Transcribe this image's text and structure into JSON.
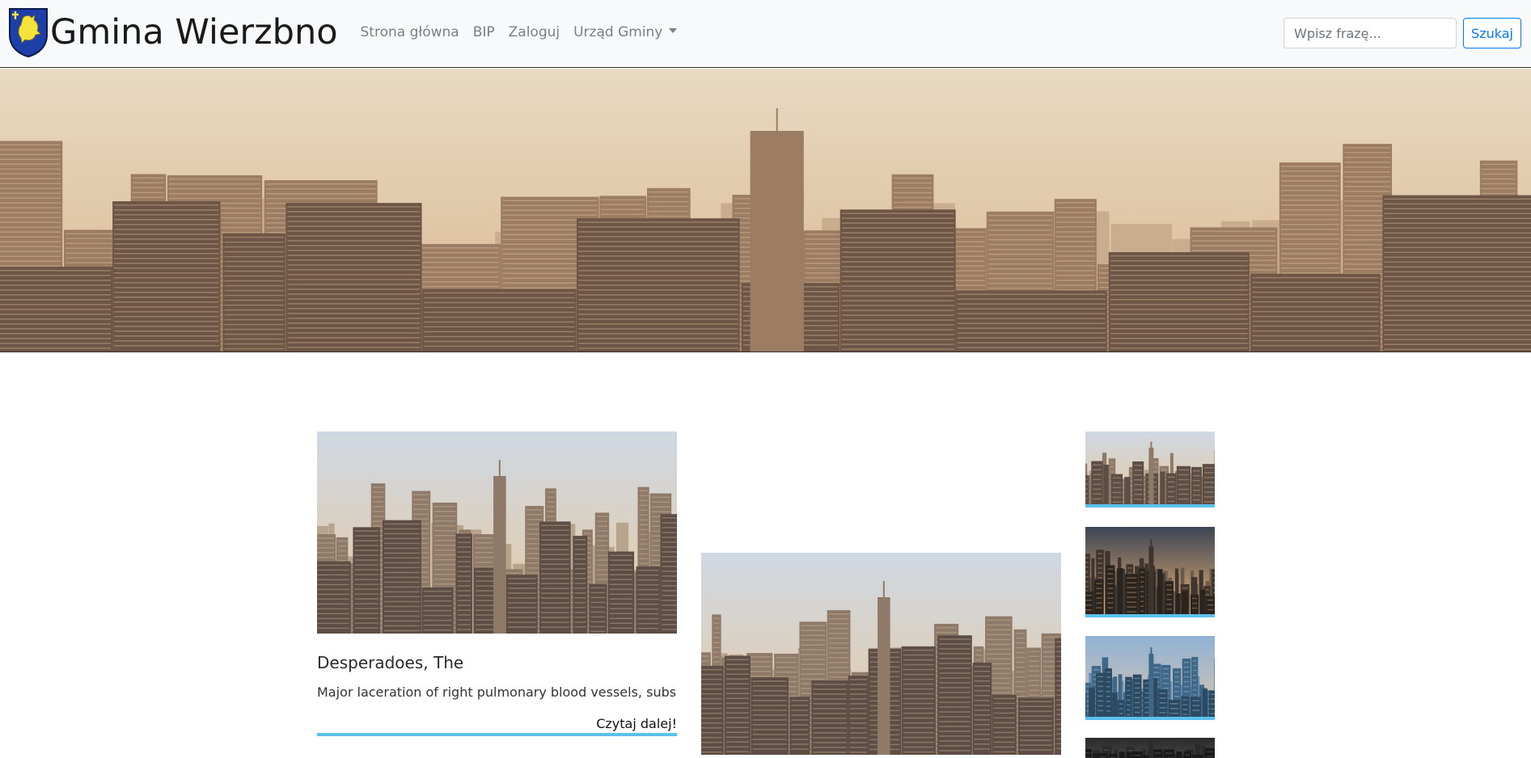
{
  "site": {
    "title": "Gmina Wierzbno"
  },
  "nav": {
    "items": [
      "Strona główna",
      "BIP",
      "Zaloguj",
      "Urząd Gminy"
    ]
  },
  "search": {
    "placeholder": "Wpisz frazę...",
    "button_label": "Szukaj"
  },
  "articles": [
    {
      "title": "Desperadoes, The",
      "excerpt": "Major laceration of right pulmonary blood vessels, subs",
      "read_more": "Czytaj dalej!"
    }
  ],
  "colors": {
    "navbar_bg": "#f8f9fa",
    "accent_bar": "#5bc0eb",
    "button_blue": "#007bff",
    "nav_link": "#7b7f83",
    "crest_blue": "#1f3fa8",
    "crest_yellow": "#f5e23a"
  },
  "icons": {
    "crest": "coat-of-arms-icon",
    "dropdown": "caret-down-icon"
  }
}
